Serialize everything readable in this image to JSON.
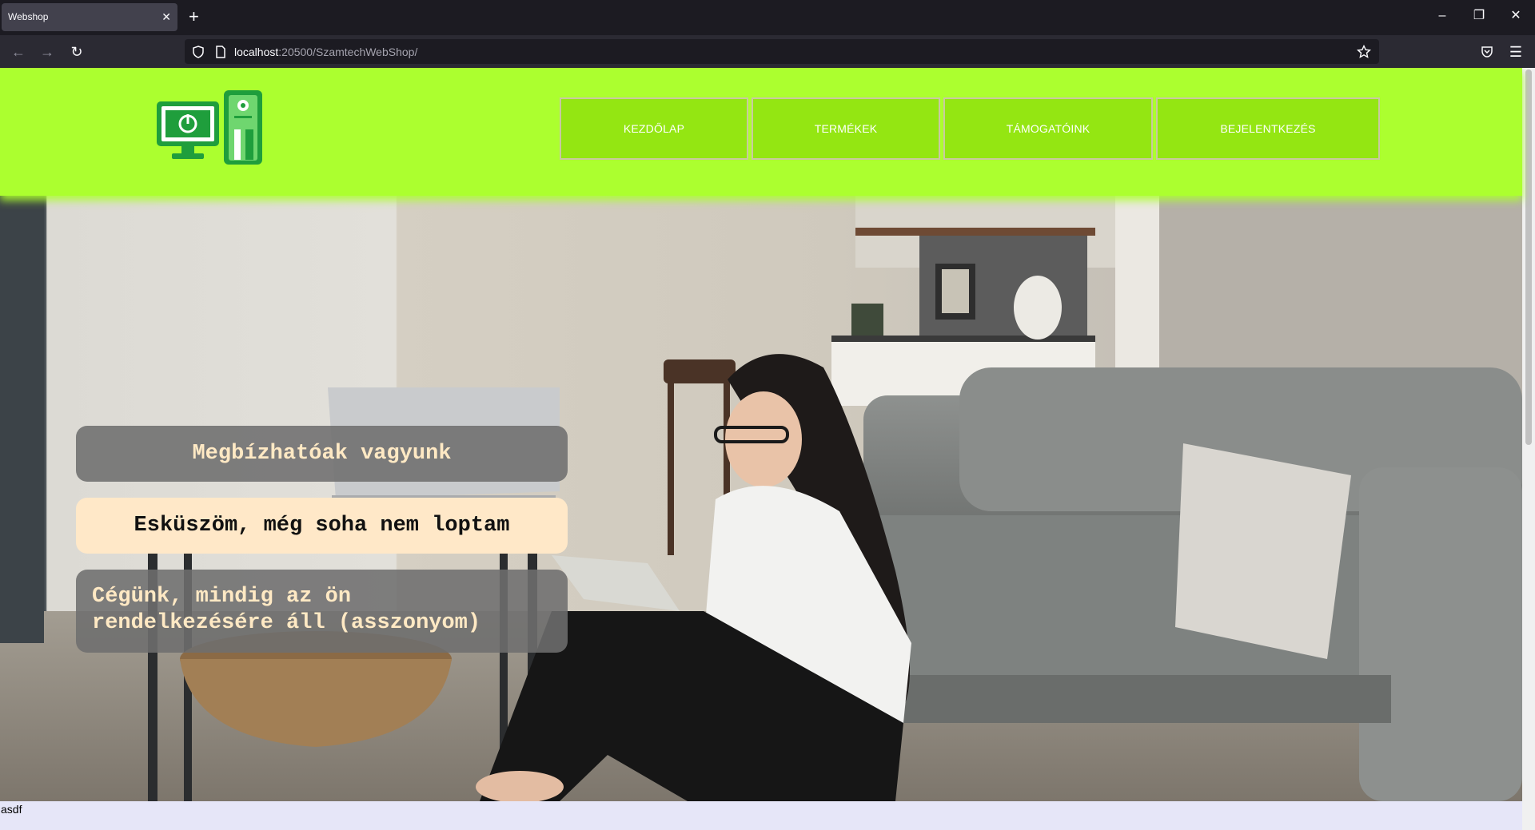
{
  "browser": {
    "tab_title": "Webshop",
    "url_host": "localhost",
    "url_path": ":20500/SzamtechWebShop/"
  },
  "site": {
    "menu": [
      {
        "label": "KEZDŐLAP"
      },
      {
        "label": "TERMÉKEK"
      },
      {
        "label": "TÁMOGATÓINK"
      },
      {
        "label": "BEJELENTKEZÉS"
      }
    ],
    "accent": "#acff2f",
    "menu_bg": "#94e612"
  },
  "hero": {
    "box1": "Megbízhatóak vagyunk",
    "box2": "Esküszöm, még soha nem loptam",
    "box3_line1": "Cégünk, mindig az ön",
    "box3_line2": "rendelkezésére áll (asszonyom)"
  },
  "footer": {
    "text": "asdf"
  }
}
